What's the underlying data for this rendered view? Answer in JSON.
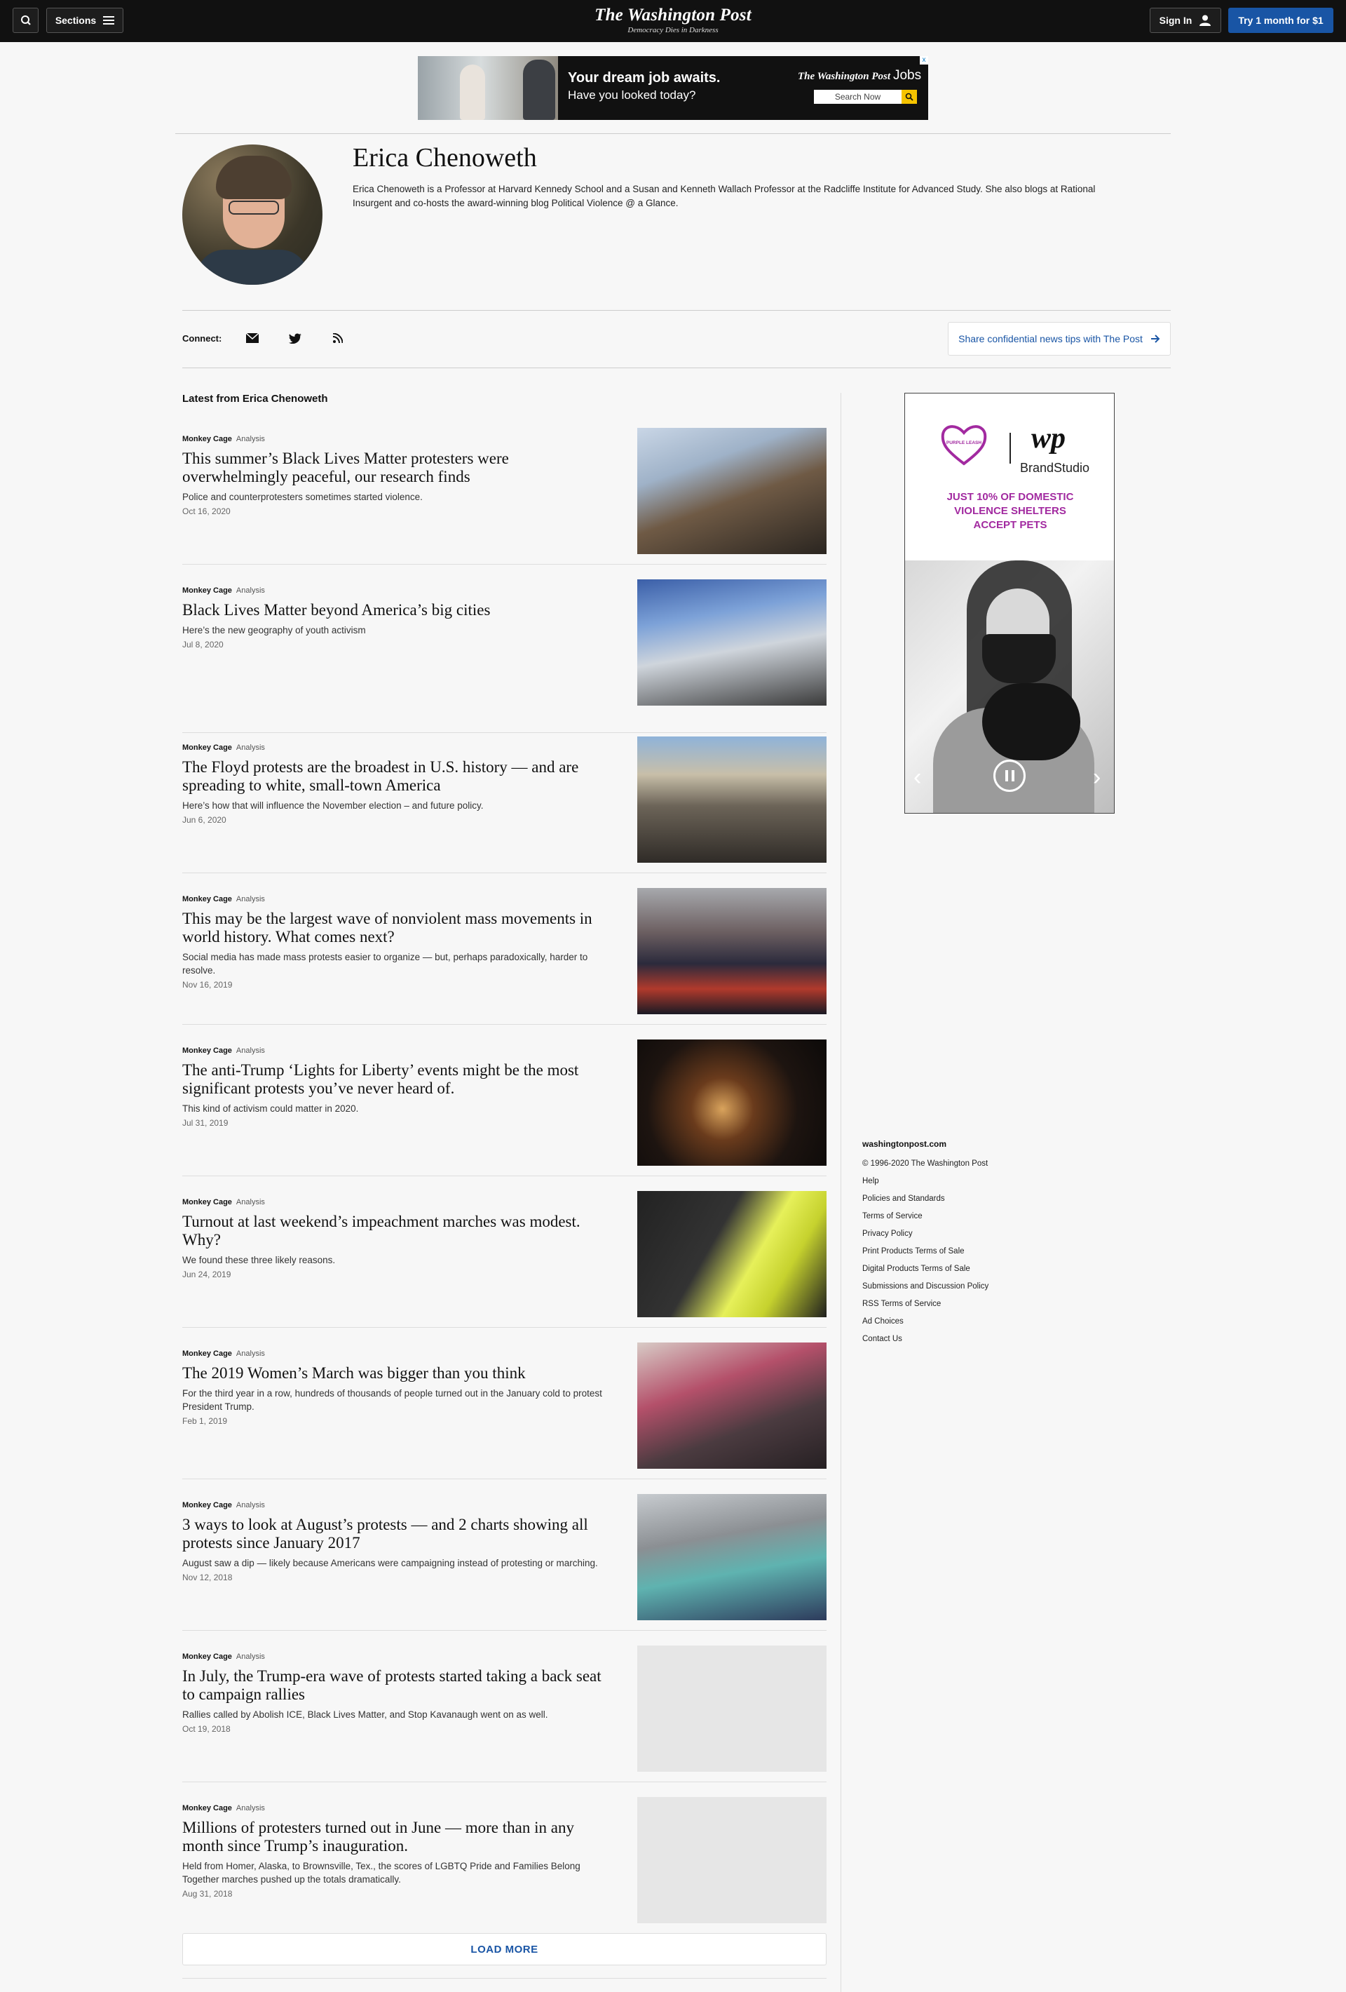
{
  "header": {
    "sections_label": "Sections",
    "logo": "The Washington Post",
    "tagline": "Democracy Dies in Darkness",
    "signin_label": "Sign In",
    "subscribe_label": "Try 1 month for $1"
  },
  "top_ad": {
    "headline": "Your dream job awaits.",
    "subheadline": "Have you looked today?",
    "brand": "The Washington Post",
    "brand_suffix": "Jobs",
    "search_button": "Search Now",
    "close": "x"
  },
  "author": {
    "name": "Erica Chenoweth",
    "bio": "Erica Chenoweth is a Professor at Harvard Kennedy School and a Susan and Kenneth Wallach Professor at the Radcliffe Institute for Advanced Study. She also blogs at Rational Insurgent and co-hosts the award-winning blog Political Violence @ a Glance."
  },
  "connect": {
    "label": "Connect:",
    "icons": [
      "email-icon",
      "twitter-icon",
      "rss-icon"
    ],
    "tips_label": "Share confidential news tips with The Post"
  },
  "latest_title": "Latest from Erica Chenoweth",
  "articles": [
    {
      "section": "Monkey Cage",
      "label": "Analysis",
      "headline": "This summer’s Black Lives Matter protesters were overwhelmingly peaceful, our research finds",
      "blurb": "Police and counterprotesters sometimes started violence.",
      "date": "Oct 16, 2020"
    },
    {
      "section": "Monkey Cage",
      "label": "Analysis",
      "headline": "Black Lives Matter beyond America’s big cities",
      "blurb": "Here’s the new geography of youth activism",
      "date": "Jul 8, 2020"
    },
    {
      "section": "Monkey Cage",
      "label": "Analysis",
      "headline": "The Floyd protests are the broadest in U.S. history — and are spreading to white, small-town America",
      "blurb": "Here’s how that will influence the November election – and future policy.",
      "date": "Jun 6, 2020"
    },
    {
      "section": "Monkey Cage",
      "label": "Analysis",
      "headline": "This may be the largest wave of nonviolent mass movements in world history. What comes next?",
      "blurb": "Social media has made mass protests easier to organize — but, perhaps paradoxically, harder to resolve.",
      "date": "Nov 16, 2019"
    },
    {
      "section": "Monkey Cage",
      "label": "Analysis",
      "headline": "The anti-Trump ‘Lights for Liberty’ events might be the most significant protests you’ve never heard of.",
      "blurb": "This kind of activism could matter in 2020.",
      "date": "Jul 31, 2019"
    },
    {
      "section": "Monkey Cage",
      "label": "Analysis",
      "headline": "Turnout at last weekend’s impeachment marches was modest. Why?",
      "blurb": "We found these three likely reasons.",
      "date": "Jun 24, 2019"
    },
    {
      "section": "Monkey Cage",
      "label": "Analysis",
      "headline": "The 2019 Women’s March was bigger than you think",
      "blurb": "For the third year in a row, hundreds of thousands of people turned out in the January cold to protest President Trump.",
      "date": "Feb 1, 2019"
    },
    {
      "section": "Monkey Cage",
      "label": "Analysis",
      "headline": "3 ways to look at August’s protests — and 2 charts showing all protests since January 2017",
      "blurb": "August saw a dip — likely because Americans were campaigning instead of protesting or marching.",
      "date": "Nov 12, 2018"
    },
    {
      "section": "Monkey Cage",
      "label": "Analysis",
      "headline": "In July, the Trump-era wave of protests started taking a back seat to campaign rallies",
      "blurb": "Rallies called by Abolish ICE, Black Lives Matter, and Stop Kavanaugh went on as well.",
      "date": "Oct 19, 2018"
    },
    {
      "section": "Monkey Cage",
      "label": "Analysis",
      "headline": "Millions of protesters turned out in June — more than in any month since Trump’s inauguration.",
      "blurb": "Held from Homer, Alaska, to Brownsville, Tex., the scores of LGBTQ Pride and Families Belong Together marches pushed up the totals dramatically.",
      "date": "Aug 31, 2018"
    }
  ],
  "load_more": "LOAD MORE",
  "side_ad": {
    "logo_text": "PURPLE LEASH",
    "brand_logo": "wp",
    "brand_studio": "BrandStudio",
    "message_lines": [
      "JUST 10% OF DOMESTIC",
      "VIOLENCE SHELTERS",
      "ACCEPT PETS"
    ]
  },
  "footer": {
    "site": "washingtonpost.com",
    "links": [
      "© 1996-2020 The Washington Post",
      "Help",
      "Policies and Standards",
      "Terms of Service",
      "Privacy Policy",
      "Print Products Terms of Sale",
      "Digital Products Terms of Sale",
      "Submissions and Discussion Policy",
      "RSS Terms of Service",
      "Ad Choices",
      "Contact Us"
    ]
  },
  "colors": {
    "topbar": "#111111",
    "accent_blue": "#1955a5",
    "ad_purple": "#a22aa0",
    "background": "#f7f7f7"
  }
}
